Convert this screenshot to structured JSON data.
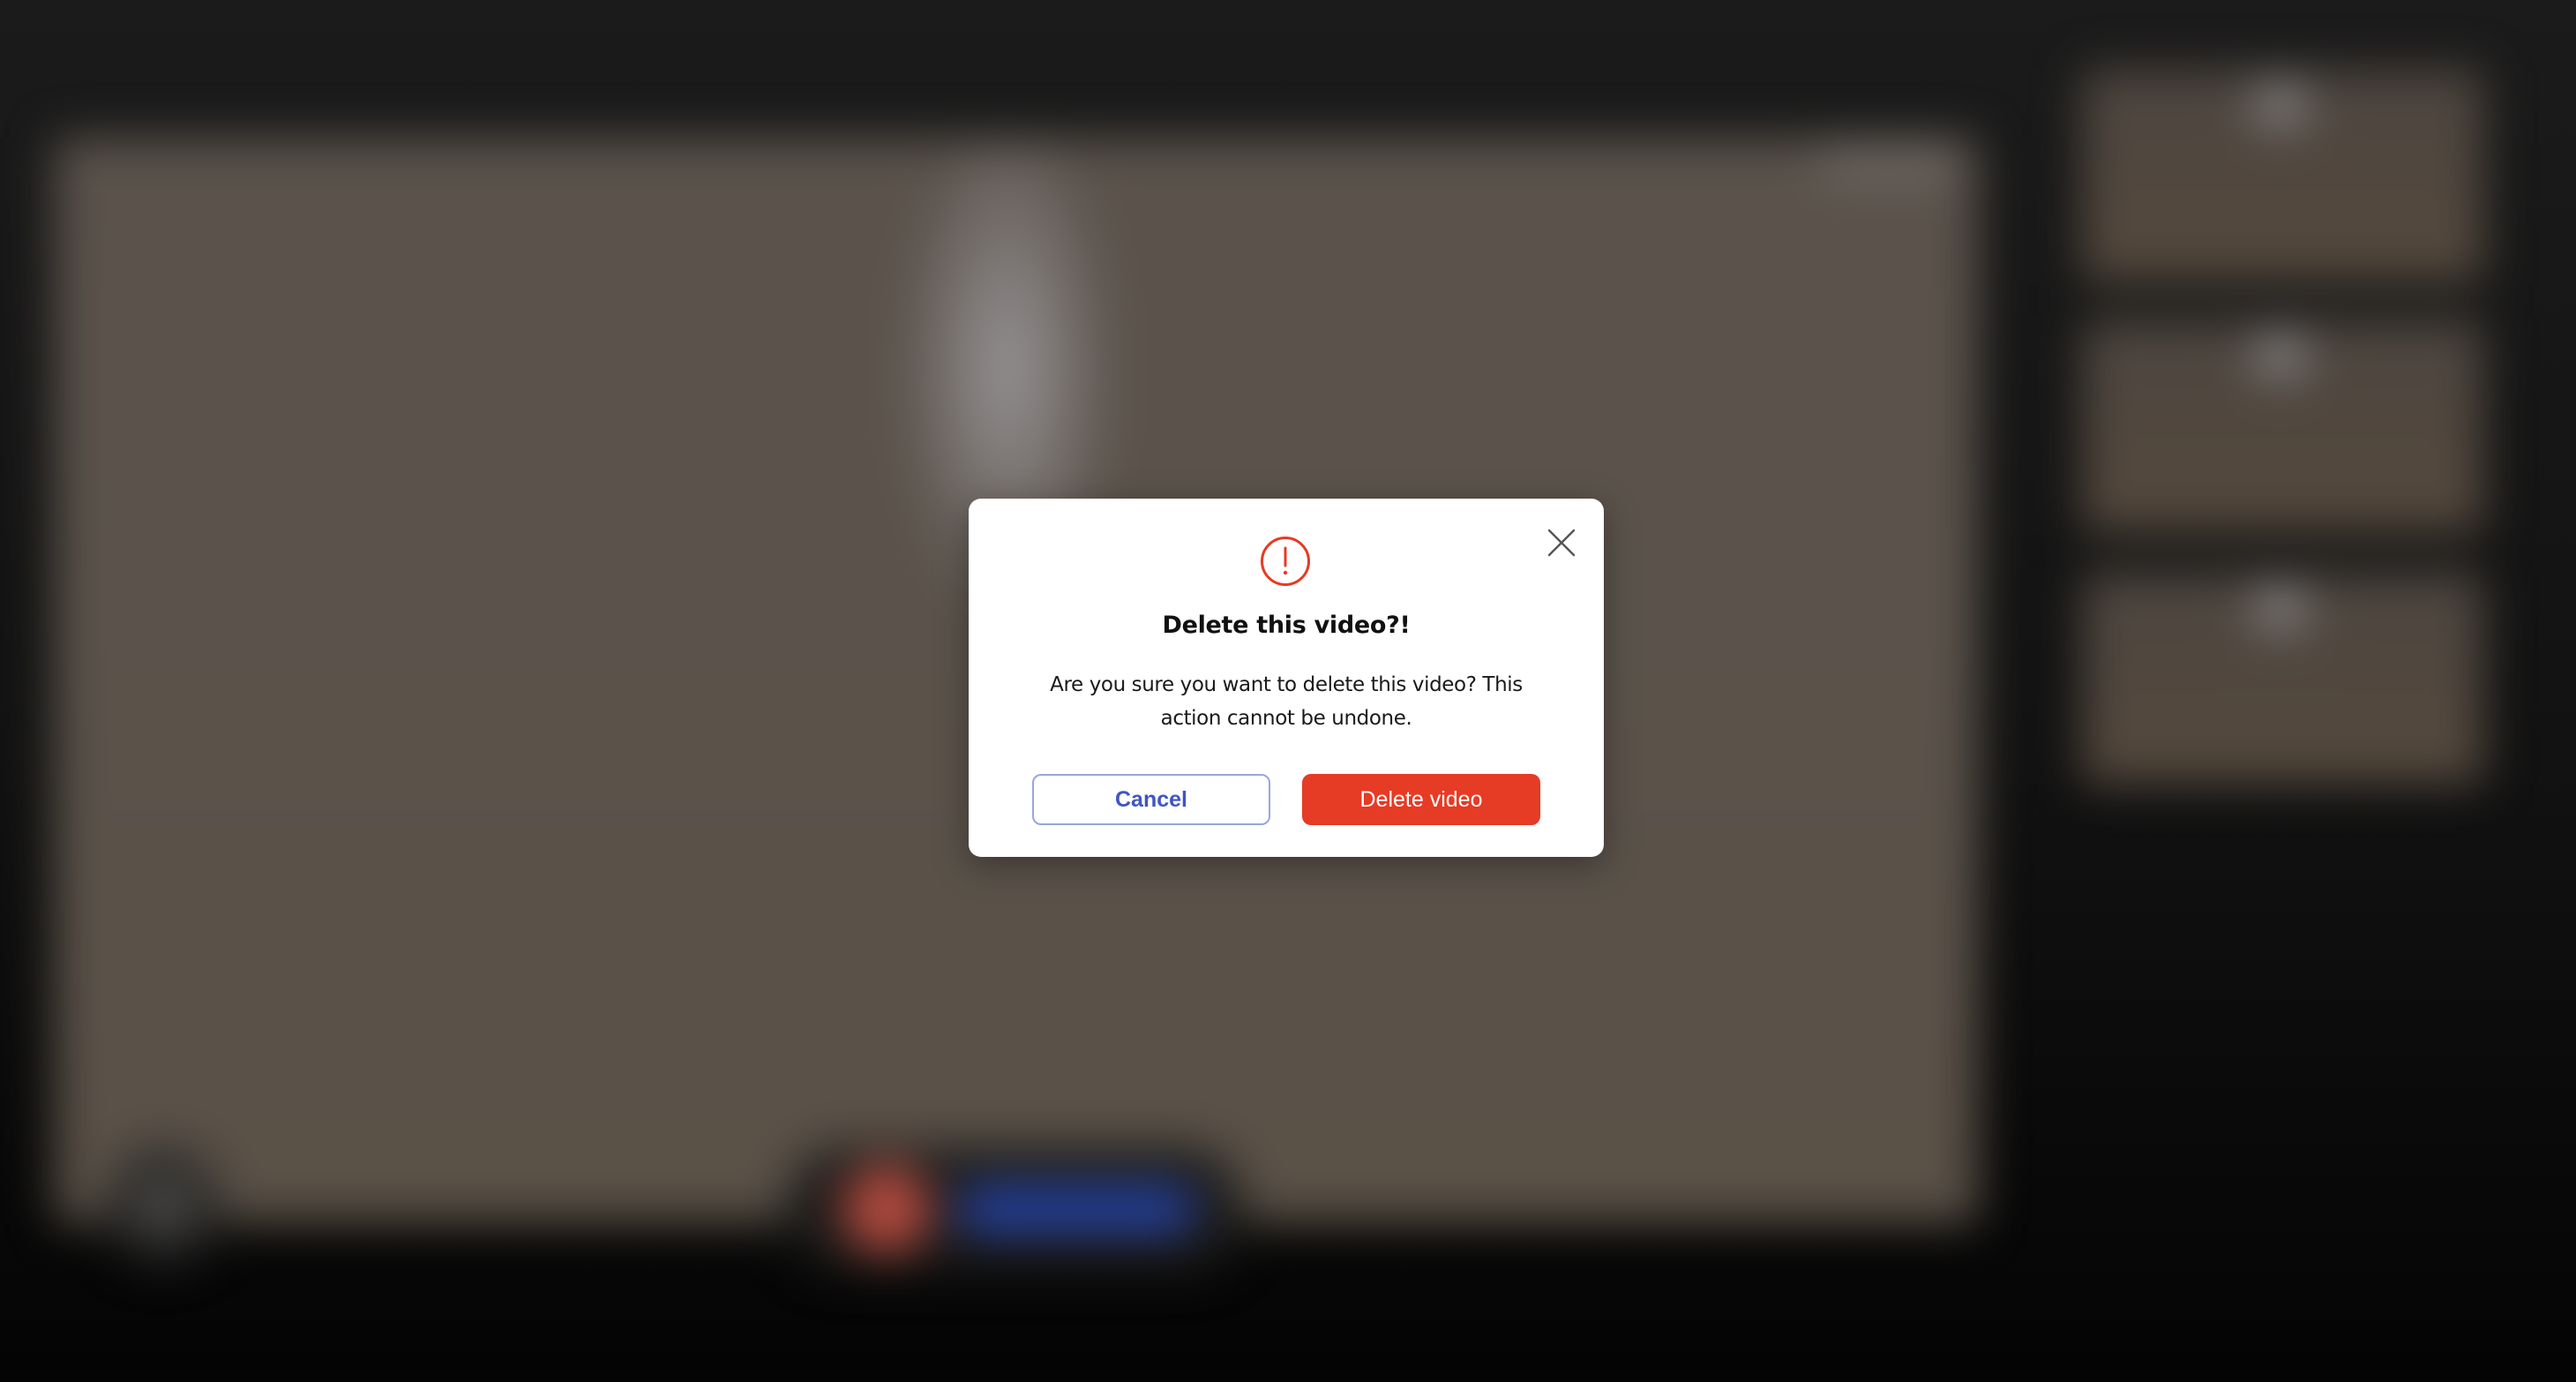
{
  "dialog": {
    "title": "Delete this video?!",
    "message": "Are you sure you want to delete this video? This action cannot be undone.",
    "cancel_label": "Cancel",
    "confirm_label": "Delete video",
    "icons": {
      "warning": "exclamation-circle-icon",
      "close": "close-icon"
    }
  },
  "colors": {
    "warning_accent": "#e63b24",
    "confirm_button": "#e63b24",
    "cancel_text": "#3f55c5",
    "cancel_border": "#98a6dd"
  }
}
